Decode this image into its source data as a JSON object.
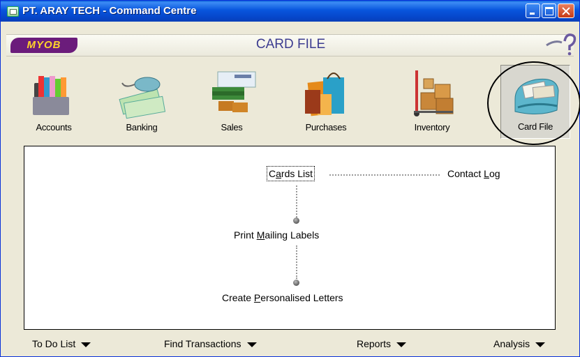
{
  "window": {
    "title": "PT. ARAY TECH - Command Centre"
  },
  "header": {
    "logo": "MYOB",
    "page_title": "CARD FILE"
  },
  "modules": [
    {
      "label": "Accounts"
    },
    {
      "label": "Banking"
    },
    {
      "label": "Sales"
    },
    {
      "label": "Purchases"
    },
    {
      "label": "Inventory"
    },
    {
      "label": "Card File",
      "selected": true
    }
  ],
  "flow": {
    "cards_list": {
      "pre": "C",
      "u": "a",
      "post": "rds List"
    },
    "contact_log": {
      "pre": "Contact ",
      "u": "L",
      "post": "og"
    },
    "print_mailing": {
      "pre": "Print ",
      "u": "M",
      "post": "ailing Labels"
    },
    "create_letters": {
      "pre": "Create ",
      "u": "P",
      "post": "ersonalised Letters"
    }
  },
  "bottom": {
    "todo": "To Do List",
    "find": "Find Transactions",
    "reports": "Reports",
    "analysis": "Analysis"
  }
}
